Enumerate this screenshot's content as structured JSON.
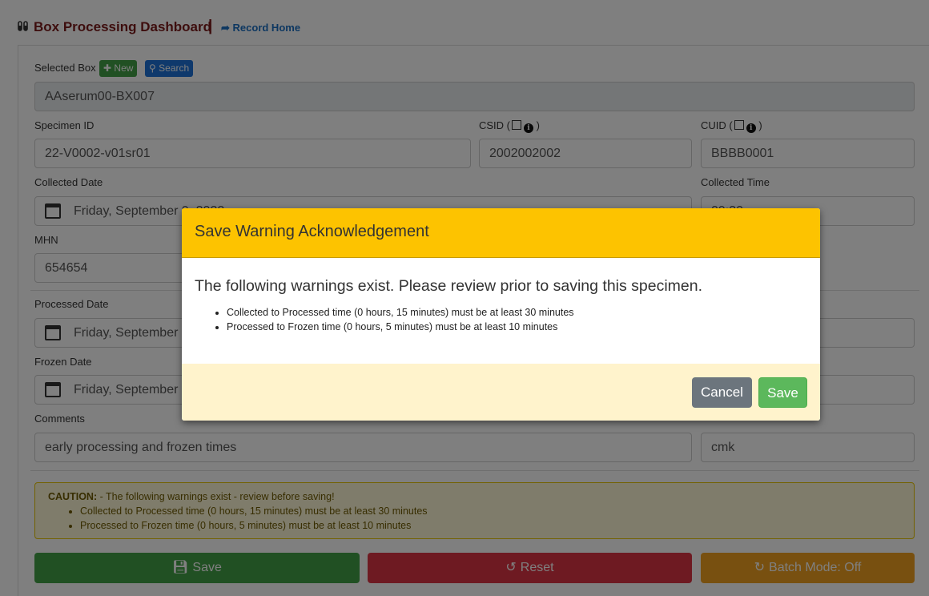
{
  "header": {
    "title": "Box Processing Dashboard",
    "separator": "|",
    "record_home": "Record Home"
  },
  "form": {
    "selected_box_label": "Selected Box",
    "new_button": "New",
    "search_button": "Search",
    "selected_box_value": "AAserum00-BX007",
    "specimen_id_label": "Specimen ID",
    "specimen_id_value": "22-V0002-v01sr01",
    "csid_label_open": "CSID (",
    "csid_label_close": ")",
    "csid_value": "2002002002",
    "cuid_label_open": "CUID (",
    "cuid_label_close": ")",
    "cuid_value": "BBBB0001",
    "collected_date_label": "Collected Date",
    "collected_date_value": "Friday, September 9, 2022",
    "collected_time_label": "Collected Time",
    "collected_time_value": "09:30",
    "mhn_label": "MHN",
    "mhn_value": "654654",
    "processed_date_label": "Processed Date",
    "processed_date_value": "Friday, September",
    "frozen_date_label": "Frozen Date",
    "frozen_date_value": "Friday, September",
    "comments_label": "Comments",
    "comments_value": "early processing and frozen times",
    "processed_tech_value": "cmk"
  },
  "caution": {
    "prefix": "CAUTION:",
    "text": " - The following warnings exist - review before saving!",
    "items": [
      "Collected to Processed time (0 hours, 15 minutes) must be at least 30 minutes",
      "Processed to Frozen time (0 hours, 5 minutes) must be at least 10 minutes"
    ]
  },
  "actions": {
    "save": "Save",
    "reset": "Reset",
    "batch_mode": "Batch Mode: Off"
  },
  "modal": {
    "title": "Save Warning Acknowledgement",
    "lead": "The following warnings exist. Please review prior to saving this specimen.",
    "items": [
      "Collected to Processed time (0 hours, 15 minutes) must be at least 30 minutes",
      "Processed to Frozen time (0 hours, 5 minutes) must be at least 10 minutes"
    ],
    "cancel": "Cancel",
    "save": "Save"
  },
  "colors": {
    "title": "#7b1b1b",
    "link": "#1a6fc2",
    "modal_header": "#fdc300",
    "modal_footer": "#fff3cc",
    "save_green": "#43a047",
    "reset_red": "#dc3545",
    "batch_orange": "#f0a020",
    "cancel_gray": "#6c757d"
  },
  "icons": {
    "app": "test-tubes-icon",
    "home": "share-arrow-icon",
    "new": "plus-icon",
    "search": "search-icon",
    "calendar": "calendar-icon",
    "info": "info-circle-icon",
    "save": "floppy-disk-icon",
    "reset": "undo-icon",
    "batch": "refresh-icon"
  }
}
